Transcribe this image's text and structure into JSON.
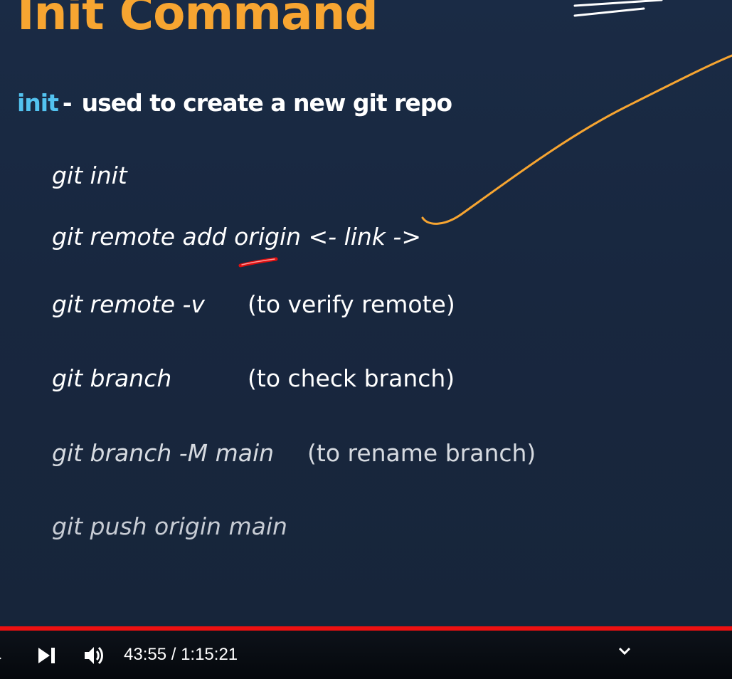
{
  "slide": {
    "title": "Init Command",
    "subtitle": {
      "keyword": "init",
      "separator": "-",
      "description": "used to create a new git repo"
    },
    "commands": [
      {
        "command": "git init",
        "note": ""
      },
      {
        "command": "git remote add origin <- link ->",
        "note": ""
      },
      {
        "command": "git remote -v",
        "note": "(to verify remote)"
      },
      {
        "command": "git branch",
        "note": "(to check branch)"
      },
      {
        "command": "git branch -M main",
        "note": "(to rename branch)"
      },
      {
        "command": "git push origin main",
        "note": ""
      }
    ],
    "colors": {
      "title": "#f7a531",
      "keyword": "#53c3f0",
      "annotation_orange": "#f7a531",
      "annotation_red": "#e01010"
    }
  },
  "player": {
    "progress_fraction": 0.58,
    "time_display": "43:55 / 1:15:21",
    "icons": {
      "next": "skip-next-icon",
      "volume": "volume-icon",
      "expand": "chevron-down-icon"
    },
    "colors": {
      "progress": "#ee1111"
    }
  }
}
